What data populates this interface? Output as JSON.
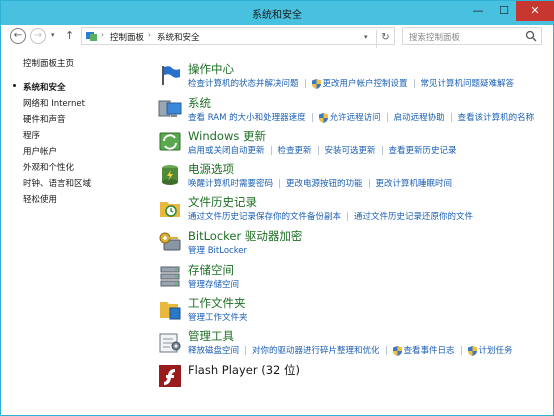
{
  "window": {
    "title": "系统和安全"
  },
  "titlebar": {
    "minimize": "—",
    "maximize": "☐",
    "close": "✕"
  },
  "address": {
    "back": "←",
    "forward": "→",
    "dropdown": "▾",
    "up": "↑",
    "breadcrumb": [
      "控制面板",
      "系统和安全"
    ],
    "sep": "›",
    "refresh": "↻",
    "search_placeholder": "搜索控制面板"
  },
  "sidebar": {
    "items": [
      "控制面板主页",
      "系统和安全",
      "网络和 Internet",
      "硬件和声音",
      "程序",
      "用户帐户",
      "外观和个性化",
      "时钟、语言和区域",
      "轻松使用"
    ],
    "selected_index": 1
  },
  "categories": [
    {
      "title": "操作中心",
      "links": [
        "检查计算机的状态并解决问题",
        "更改用户帐户控制设置",
        "常见计算机问题疑难解答"
      ]
    },
    {
      "title": "系统",
      "links": [
        "查看 RAM 的大小和处理器速度",
        "允许远程访问",
        "启动远程协助",
        "查看该计算机的名称"
      ]
    },
    {
      "title": "Windows 更新",
      "links": [
        "启用或关闭自动更新",
        "检查更新",
        "安装可选更新",
        "查看更新历史记录"
      ]
    },
    {
      "title": "电源选项",
      "links": [
        "唤醒计算机时需要密码",
        "更改电源按钮的功能",
        "更改计算机睡眠时间"
      ]
    },
    {
      "title": "文件历史记录",
      "links": [
        "通过文件历史记录保存你的文件备份副本",
        "通过文件历史记录还原你的文件"
      ]
    },
    {
      "title": "BitLocker 驱动器加密",
      "links": [
        "管理 BitLocker"
      ]
    },
    {
      "title": "存储空间",
      "links": [
        "管理存储空间"
      ]
    },
    {
      "title": "工作文件夹",
      "links": [
        "管理工作文件夹"
      ]
    },
    {
      "title": "管理工具",
      "links": [
        "释放磁盘空间",
        "对你的驱动器进行碎片整理和优化",
        "创建并格式化硬盘分区",
        "查看事件日志",
        "计划任务"
      ]
    },
    {
      "title": "Flash Player (32 位)",
      "links": []
    }
  ],
  "colors": {
    "titlebar": "#48c0e0",
    "heading": "#1e6f24",
    "link": "#1a5fb4",
    "close": "#c7372f"
  }
}
